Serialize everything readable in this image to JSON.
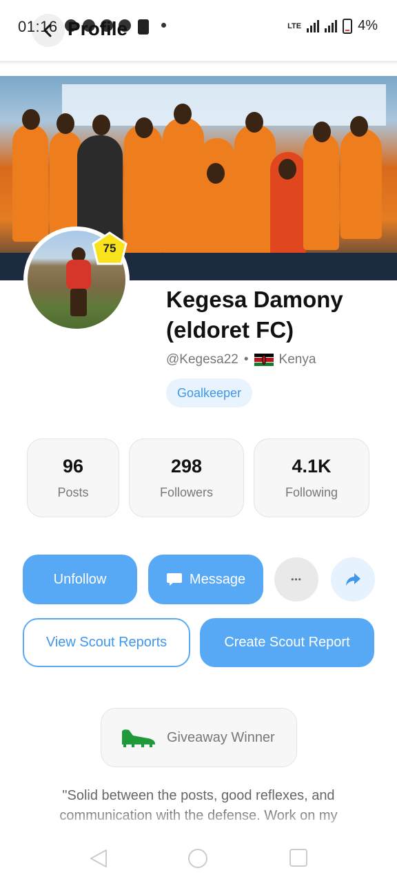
{
  "status_bar": {
    "time": "01:16",
    "network": "LTE",
    "battery": "4%"
  },
  "header": {
    "title": "Profile"
  },
  "profile": {
    "rating": "75",
    "name": "Kegesa Damony (eldoret FC)",
    "handle": "@Kegesa22",
    "separator": "•",
    "country": "Kenya",
    "position": "Goalkeeper"
  },
  "stats": [
    {
      "value": "96",
      "label": "Posts"
    },
    {
      "value": "298",
      "label": "Followers"
    },
    {
      "value": "4.1K",
      "label": "Following"
    }
  ],
  "actions": {
    "unfollow": "Unfollow",
    "message": "Message",
    "more": "•••",
    "view_reports": "View Scout Reports",
    "create_report": "Create Scout Report"
  },
  "award": {
    "label": "Giveaway Winner"
  },
  "bio": "\"Solid between the posts, good reflexes, and communication with the defense. Work on my",
  "colors": {
    "accent": "#58a9f5",
    "accent_text": "#3e97ec",
    "badge": "#f7e21b",
    "award_icon": "#1f9a3a"
  },
  "icons": [
    "back-arrow-icon",
    "speech-bubble-icon",
    "more-dots-icon",
    "share-arrow-icon",
    "football-boot-icon",
    "kenya-flag-icon"
  ]
}
